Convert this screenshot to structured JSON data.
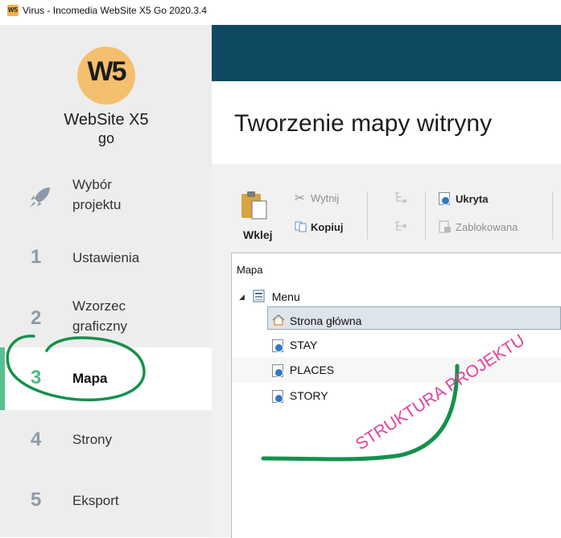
{
  "window": {
    "icon_text": "W5",
    "title": "Virus - Incomedia WebSite X5 Go 2020.3.4"
  },
  "logo": {
    "mark": "W5",
    "name": "WebSite X5",
    "sub": "go"
  },
  "nav": [
    {
      "num": "",
      "icon": "rocket-icon",
      "label_line1": "Wybór",
      "label_line2": "projektu"
    },
    {
      "num": "1",
      "label": "Ustawienia"
    },
    {
      "num": "2",
      "label_line1": "Wzorzec",
      "label_line2": "graficzny"
    },
    {
      "num": "3",
      "label": "Mapa",
      "active": true
    },
    {
      "num": "4",
      "label": "Strony"
    },
    {
      "num": "5",
      "label": "Eksport"
    }
  ],
  "header": {
    "title": "Tworzenie mapy witryny"
  },
  "toolbar": {
    "paste": "Wklej",
    "cut": "Wytnij",
    "copy": "Kopiuj",
    "hidden": "Ukryta",
    "locked": "Zablokowana"
  },
  "tree": {
    "header": "Mapa",
    "root": "Menu",
    "items": [
      "Strona główna",
      "STAY",
      "PLACES",
      "STORY"
    ]
  },
  "annotation": {
    "text": "STRUKTURA PROJEKTU"
  },
  "colors": {
    "accent": "#5ac18e",
    "header_band": "#0e4a5f",
    "annotation_pink": "#e8409c",
    "annotation_green": "#14914a"
  }
}
